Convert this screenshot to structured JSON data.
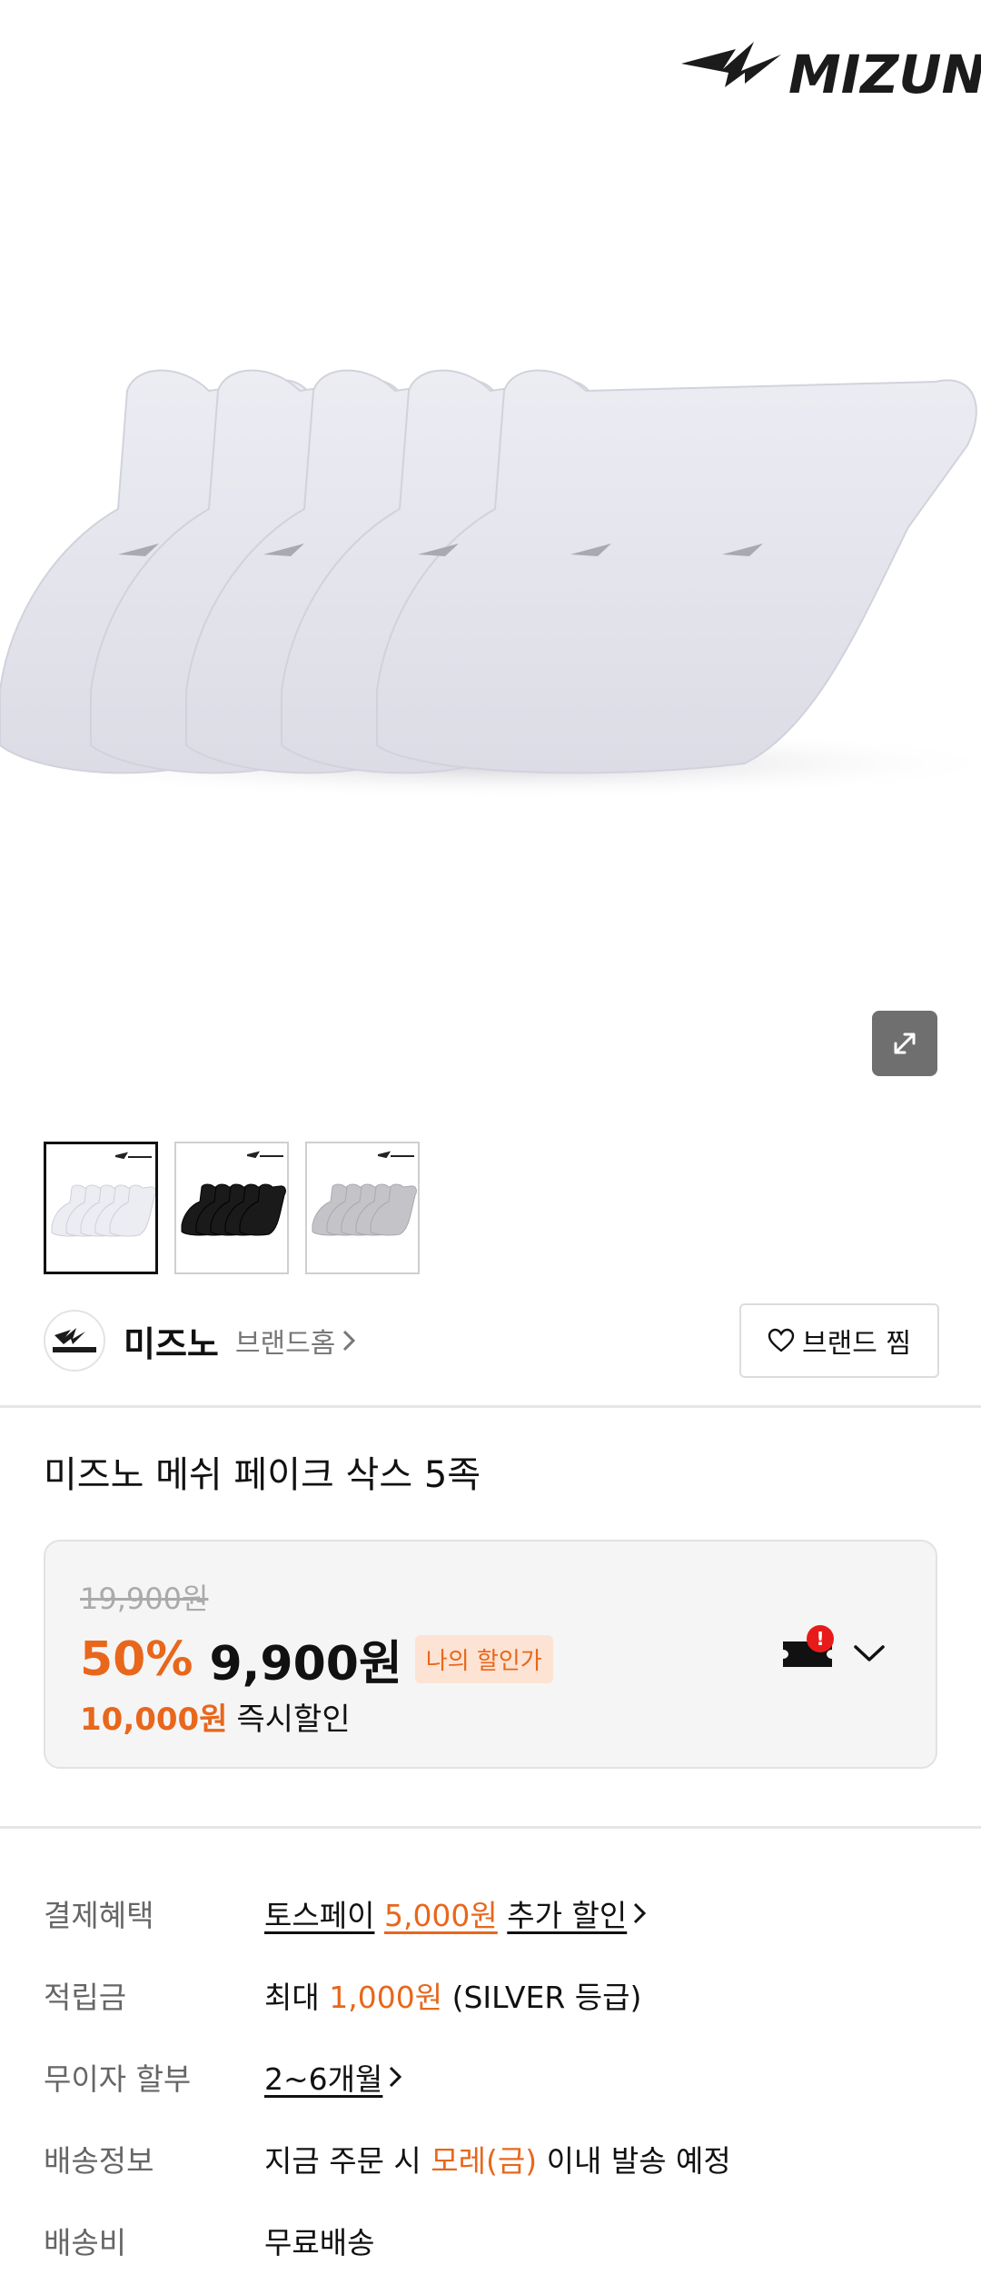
{
  "brand_logo_text": "MIZUNO",
  "gallery": {
    "thumbnails": [
      {
        "color": "white",
        "sock_color": "#e9e9f0"
      },
      {
        "color": "black",
        "sock_color": "#1a1a1a"
      },
      {
        "color": "gray",
        "sock_color": "#c2c2c2"
      }
    ],
    "expand_icon": "expand-diagonal-icon"
  },
  "brand": {
    "name": "미즈노",
    "home_label": "브랜드홈",
    "like_label": "브랜드 찜"
  },
  "product": {
    "title": "미즈노 메쉬 페이크 삭스 5족"
  },
  "price": {
    "original": "19,900원",
    "discount_rate": "50%",
    "sale": "9,900원",
    "my_price_badge": "나의 할인가",
    "instant_amount": "10,000원",
    "instant_label": "즉시할인",
    "coupon_badge": "!"
  },
  "info": {
    "payment": {
      "label": "결제혜택",
      "prefix": "토스페이",
      "amount": "5,000원",
      "suffix": "추가 할인"
    },
    "points": {
      "label": "적립금",
      "prefix": "최대",
      "amount": "1,000원",
      "suffix": "(SILVER 등급)"
    },
    "installment": {
      "label": "무이자 할부",
      "value": "2~6개월"
    },
    "shipping_info": {
      "label": "배송정보",
      "prefix": "지금 주문 시",
      "date": "모레(금)",
      "suffix": "이내 발송 예정"
    },
    "shipping_fee": {
      "label": "배송비",
      "value": "무료배송"
    }
  },
  "colors": {
    "accent": "#e8671c",
    "text": "#111111",
    "muted": "#777777",
    "price_box_bg": "#f5f5f5"
  }
}
